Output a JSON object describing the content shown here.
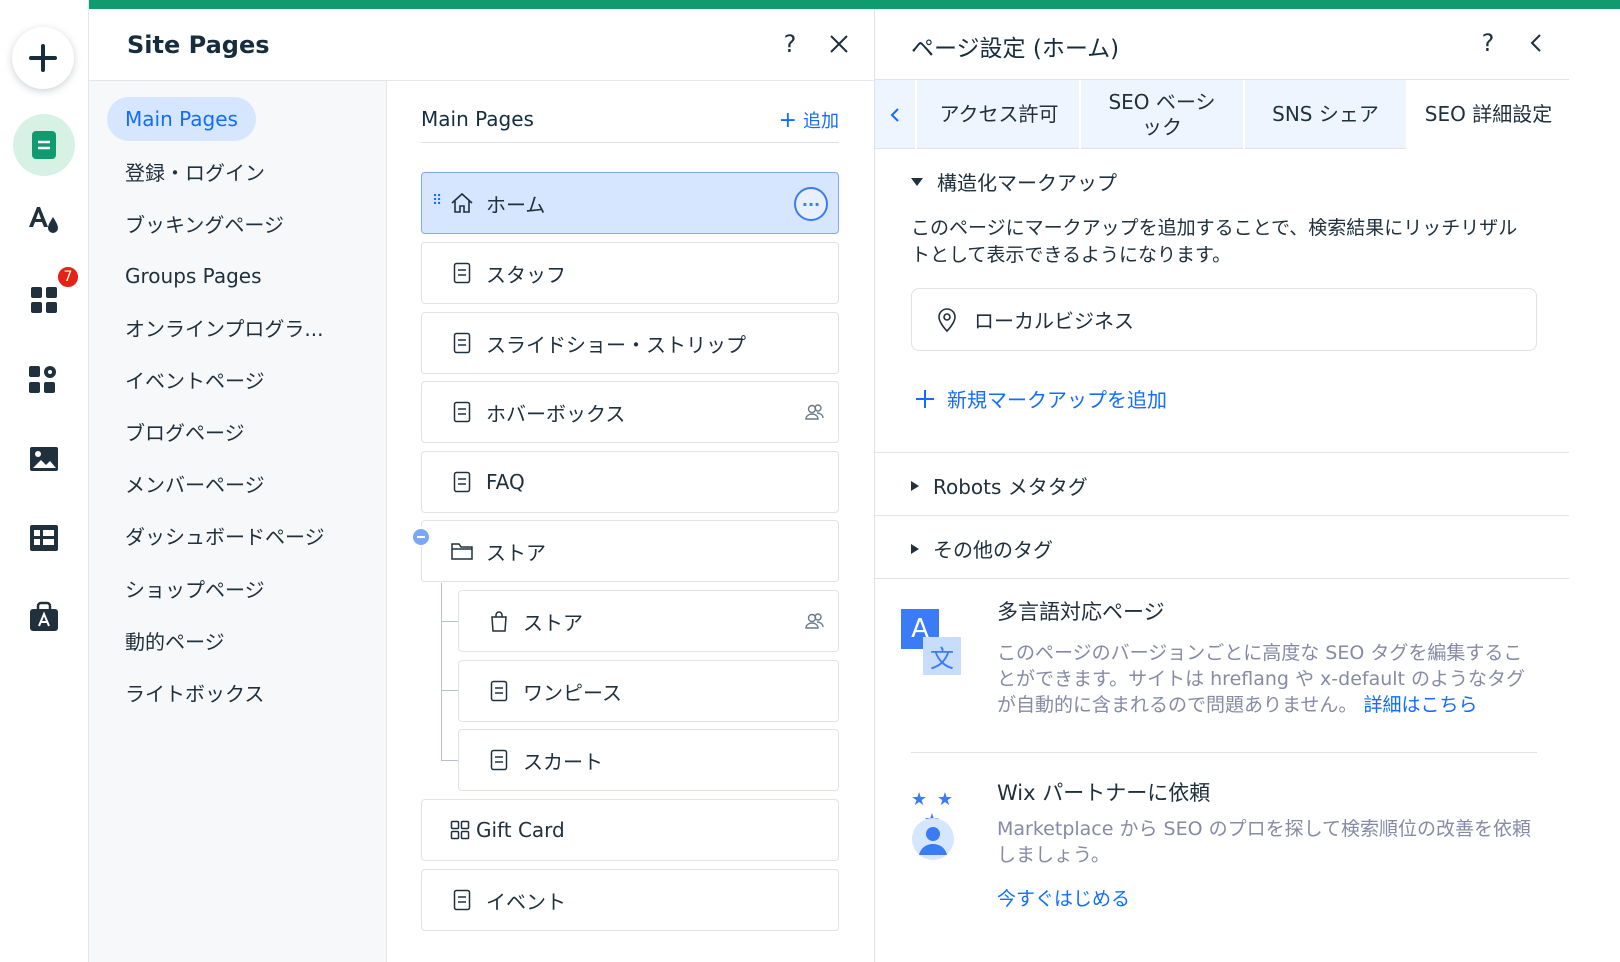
{
  "rail": {
    "badge_count": "7",
    "icons": [
      "add-icon",
      "pages-icon",
      "design-icon",
      "apps-icon",
      "business-apps-icon",
      "media-icon",
      "cms-icon",
      "app-market-icon"
    ]
  },
  "site_pages": {
    "title": "Site Pages",
    "help_label": "?",
    "close_label": "✕",
    "categories": [
      {
        "label": "Main Pages",
        "active": true
      },
      {
        "label": "登録・ログイン"
      },
      {
        "label": "ブッキングページ"
      },
      {
        "label": "Groups Pages"
      },
      {
        "label": "オンラインプログラ..."
      },
      {
        "label": "イベントページ"
      },
      {
        "label": "ブログページ"
      },
      {
        "label": "メンバーページ"
      },
      {
        "label": "ダッシュボードページ"
      },
      {
        "label": "ショップページ"
      },
      {
        "label": "動的ページ"
      },
      {
        "label": "ライトボックス"
      }
    ],
    "list_header": "Main Pages",
    "add_label": "追加",
    "add_plus": "+",
    "more_label": "···",
    "drag_label": "⠿",
    "pages": [
      {
        "label": "ホーム",
        "icon": "home-icon",
        "selected": true
      },
      {
        "label": "スタッフ",
        "icon": "page-icon"
      },
      {
        "label": "スライドショー・ストリップ",
        "icon": "page-icon"
      },
      {
        "label": "ホバーボックス",
        "icon": "page-icon",
        "members": true
      },
      {
        "label": "FAQ",
        "icon": "page-icon"
      },
      {
        "label": "ストア",
        "icon": "folder-icon"
      },
      {
        "label": "ストア",
        "icon": "shopping-bag-icon",
        "members": true,
        "child": true
      },
      {
        "label": "ワンピース",
        "icon": "page-icon",
        "child": true
      },
      {
        "label": "スカート",
        "icon": "page-icon",
        "child": true
      },
      {
        "label": "Gift Card",
        "icon": "gift-card-icon"
      },
      {
        "label": "イベント",
        "icon": "page-icon"
      }
    ]
  },
  "page_settings": {
    "title": "ページ設定 (ホーム)",
    "help_label": "?",
    "back_label": "‹",
    "tabs": [
      "アクセス許可",
      "SEO ベーシック",
      "SNS シェア",
      "SEO 詳細設定"
    ],
    "structured": {
      "toggle_label": "構造化マークアップ",
      "description": "このページにマークアップを追加することで、検索結果にリッチリザルトとして表示できるようになります。",
      "markup_item": "ローカルビジネス",
      "add_label": "新規マークアップを追加"
    },
    "robots_label": "Robots メタタグ",
    "other_tags_label": "その他のタグ",
    "multilingual": {
      "title": "多言語対応ページ",
      "description": "このページのバージョンごとに高度な SEO タグを編集することができます。サイトは hreflang や x-default のようなタグが自動的に含まれるので問題ありません。",
      "link": "詳細はこちら",
      "icon_letter_a": "A",
      "icon_letter_b": "文"
    },
    "partner": {
      "title": "Wix パートナーに依頼",
      "description": "Marketplace から SEO のプロを探して検索順位の改善を依頼しましょう。",
      "link": "今すぐはじめる",
      "stars": "★ ★ ★"
    }
  },
  "colors": {
    "accent": "#116dff",
    "brand_green": "#0f9b6e",
    "badge_red": "#e62214",
    "selected_bg": "#d6e6fe"
  }
}
